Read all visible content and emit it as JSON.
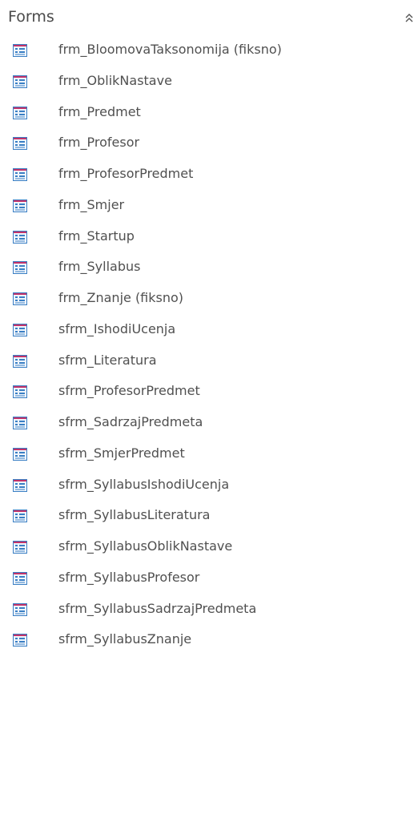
{
  "header": {
    "title": "Forms",
    "collapse_icon": "double-chevron-up-icon"
  },
  "colors": {
    "icon_border": "#3a7fc4",
    "icon_header": "#c2336a",
    "icon_bg": "#eef4fb"
  },
  "items": [
    {
      "label": "frm_BloomovaTaksonomija (fiksno)",
      "icon": "form-icon"
    },
    {
      "label": "frm_OblikNastave",
      "icon": "form-icon"
    },
    {
      "label": "frm_Predmet",
      "icon": "form-icon"
    },
    {
      "label": "frm_Profesor",
      "icon": "form-icon"
    },
    {
      "label": "frm_ProfesorPredmet",
      "icon": "form-icon"
    },
    {
      "label": "frm_Smjer",
      "icon": "form-icon"
    },
    {
      "label": "frm_Startup",
      "icon": "form-icon"
    },
    {
      "label": "frm_Syllabus",
      "icon": "form-icon"
    },
    {
      "label": "frm_Znanje (fiksno)",
      "icon": "form-icon"
    },
    {
      "label": "sfrm_IshodiUcenja",
      "icon": "form-icon"
    },
    {
      "label": "sfrm_Literatura",
      "icon": "form-icon"
    },
    {
      "label": "sfrm_ProfesorPredmet",
      "icon": "form-icon"
    },
    {
      "label": "sfrm_SadrzajPredmeta",
      "icon": "form-icon"
    },
    {
      "label": "sfrm_SmjerPredmet",
      "icon": "form-icon"
    },
    {
      "label": "sfrm_SyllabusIshodiUcenja",
      "icon": "form-icon"
    },
    {
      "label": "sfrm_SyllabusLiteratura",
      "icon": "form-icon"
    },
    {
      "label": "sfrm_SyllabusOblikNastave",
      "icon": "form-icon"
    },
    {
      "label": "sfrm_SyllabusProfesor",
      "icon": "form-icon"
    },
    {
      "label": "sfrm_SyllabusSadrzajPredmeta",
      "icon": "form-icon"
    },
    {
      "label": "sfrm_SyllabusZnanje",
      "icon": "form-icon"
    }
  ]
}
